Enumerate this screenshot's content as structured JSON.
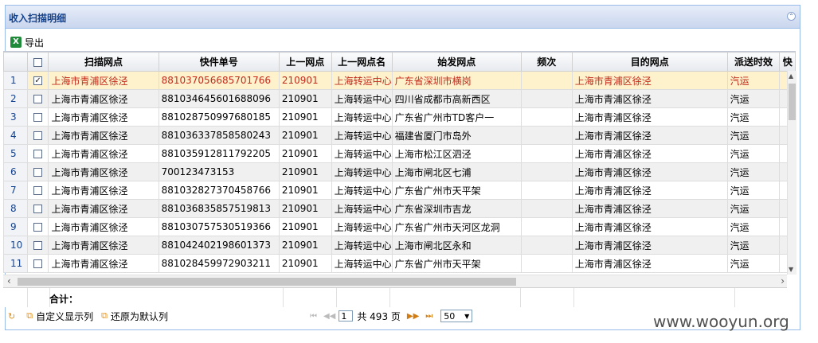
{
  "panel": {
    "title": "收入扫描明细"
  },
  "toolbar": {
    "export_label": "导出"
  },
  "grid": {
    "columns": [
      "扫描网点",
      "快件单号",
      "上一网点",
      "上一网点名",
      "始发网点",
      "频次",
      "目的网点",
      "派送时效",
      "快"
    ],
    "rows": [
      {
        "no": "1",
        "checked": true,
        "scan": "上海市青浦区徐泾",
        "waybill": "881037056685701766",
        "prev": "210901",
        "prevname": "上海转运中心",
        "origin": "广东省深圳市横岗",
        "freq": "",
        "dest": "上海市青浦区徐泾",
        "time": "汽运"
      },
      {
        "no": "2",
        "checked": false,
        "scan": "上海市青浦区徐泾",
        "waybill": "881034645601688096",
        "prev": "210901",
        "prevname": "上海转运中心",
        "origin": "四川省成都市高新西区",
        "freq": "",
        "dest": "上海市青浦区徐泾",
        "time": "汽运"
      },
      {
        "no": "3",
        "checked": false,
        "scan": "上海市青浦区徐泾",
        "waybill": "881028750997680185",
        "prev": "210901",
        "prevname": "上海转运中心",
        "origin": "广东省广州市TD客户一",
        "freq": "",
        "dest": "上海市青浦区徐泾",
        "time": "汽运"
      },
      {
        "no": "4",
        "checked": false,
        "scan": "上海市青浦区徐泾",
        "waybill": "881036337858580243",
        "prev": "210901",
        "prevname": "上海转运中心",
        "origin": "福建省厦门市岛外",
        "freq": "",
        "dest": "上海市青浦区徐泾",
        "time": "汽运"
      },
      {
        "no": "5",
        "checked": false,
        "scan": "上海市青浦区徐泾",
        "waybill": "881035912811792205",
        "prev": "210901",
        "prevname": "上海转运中心",
        "origin": "上海市松江区泗泾",
        "freq": "",
        "dest": "上海市青浦区徐泾",
        "time": "汽运"
      },
      {
        "no": "6",
        "checked": false,
        "scan": "上海市青浦区徐泾",
        "waybill": "700123473153",
        "prev": "210901",
        "prevname": "上海转运中心",
        "origin": "上海市闸北区七浦",
        "freq": "",
        "dest": "上海市青浦区徐泾",
        "time": "汽运"
      },
      {
        "no": "7",
        "checked": false,
        "scan": "上海市青浦区徐泾",
        "waybill": "881032827370458766",
        "prev": "210901",
        "prevname": "上海转运中心",
        "origin": "广东省广州市天平架",
        "freq": "",
        "dest": "上海市青浦区徐泾",
        "time": "汽运"
      },
      {
        "no": "8",
        "checked": false,
        "scan": "上海市青浦区徐泾",
        "waybill": "881036835857519813",
        "prev": "210901",
        "prevname": "上海转运中心",
        "origin": "广东省深圳市吉龙",
        "freq": "",
        "dest": "上海市青浦区徐泾",
        "time": "汽运"
      },
      {
        "no": "9",
        "checked": false,
        "scan": "上海市青浦区徐泾",
        "waybill": "881030757530519366",
        "prev": "210901",
        "prevname": "上海转运中心",
        "origin": "广东省广州市天河区龙洞",
        "freq": "",
        "dest": "上海市青浦区徐泾",
        "time": "汽运"
      },
      {
        "no": "10",
        "checked": false,
        "scan": "上海市青浦区徐泾",
        "waybill": "881042402198601373",
        "prev": "210901",
        "prevname": "上海转运中心",
        "origin": "上海市闸北区永和",
        "freq": "",
        "dest": "上海市青浦区徐泾",
        "time": "汽运"
      },
      {
        "no": "11",
        "checked": false,
        "scan": "上海市青浦区徐泾",
        "waybill": "881028459972903211",
        "prev": "210901",
        "prevname": "上海转运中心",
        "origin": "广东省广州市天平架",
        "freq": "",
        "dest": "上海市青浦区徐泾",
        "time": "汽运"
      }
    ]
  },
  "footer": {
    "total_label": "合计："
  },
  "pager": {
    "custom_display": "自定义显示列",
    "restore_default": "还原为默认列",
    "page_value": "1",
    "total_pages": "共 493 页",
    "page_size": "50"
  },
  "watermark": "www.wooyun.org",
  "colors": {
    "header_bg": "#c9d6ee",
    "selected_row": "#fdf2cc",
    "selected_text": "#c42b1c"
  }
}
